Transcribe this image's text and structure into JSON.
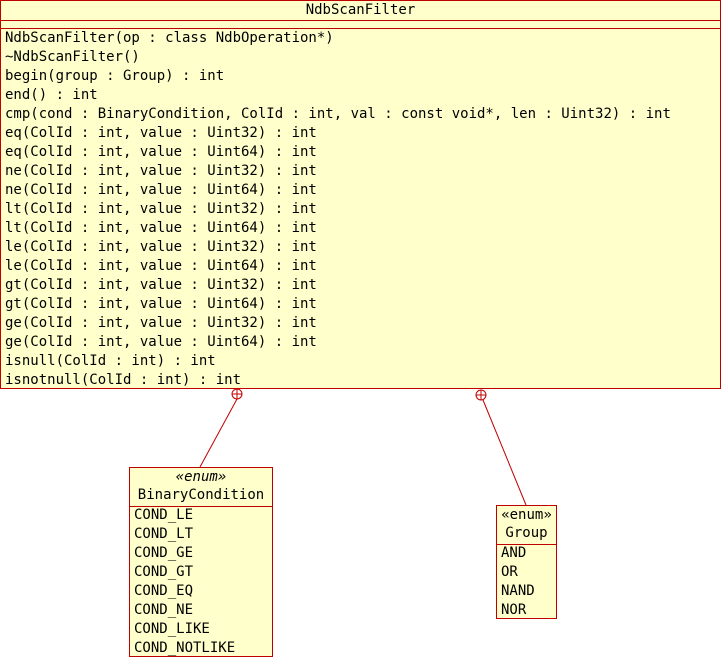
{
  "main_class": {
    "name": "NdbScanFilter",
    "operations": [
      "NdbScanFilter(op : class NdbOperation*)",
      "~NdbScanFilter()",
      "begin(group : Group) : int",
      "end() : int",
      "cmp(cond : BinaryCondition, ColId : int, val : const void*, len : Uint32) : int",
      "eq(ColId : int, value : Uint32) : int",
      "eq(ColId : int, value : Uint64) : int",
      "ne(ColId : int, value : Uint32) : int",
      "ne(ColId : int, value : Uint64) : int",
      "lt(ColId : int, value : Uint32) : int",
      "lt(ColId : int, value : Uint64) : int",
      "le(ColId : int, value : Uint32) : int",
      "le(ColId : int, value : Uint64) : int",
      "gt(ColId : int, value : Uint32) : int",
      "gt(ColId : int, value : Uint64) : int",
      "ge(ColId : int, value : Uint32) : int",
      "ge(ColId : int, value : Uint64) : int",
      "isnull(ColId : int) : int",
      "isnotnull(ColId : int) : int"
    ]
  },
  "binary_condition": {
    "stereotype": "«enum»",
    "name": "BinaryCondition",
    "literals": [
      "COND_LE",
      "COND_LT",
      "COND_GE",
      "COND_GT",
      "COND_EQ",
      "COND_NE",
      "COND_LIKE",
      "COND_NOTLIKE"
    ]
  },
  "group": {
    "stereotype": "«enum»",
    "name": "Group",
    "literals": [
      "AND",
      "OR",
      "NAND",
      "NOR"
    ]
  },
  "colors": {
    "border": "#c00000",
    "fill": "#ffffcc"
  }
}
